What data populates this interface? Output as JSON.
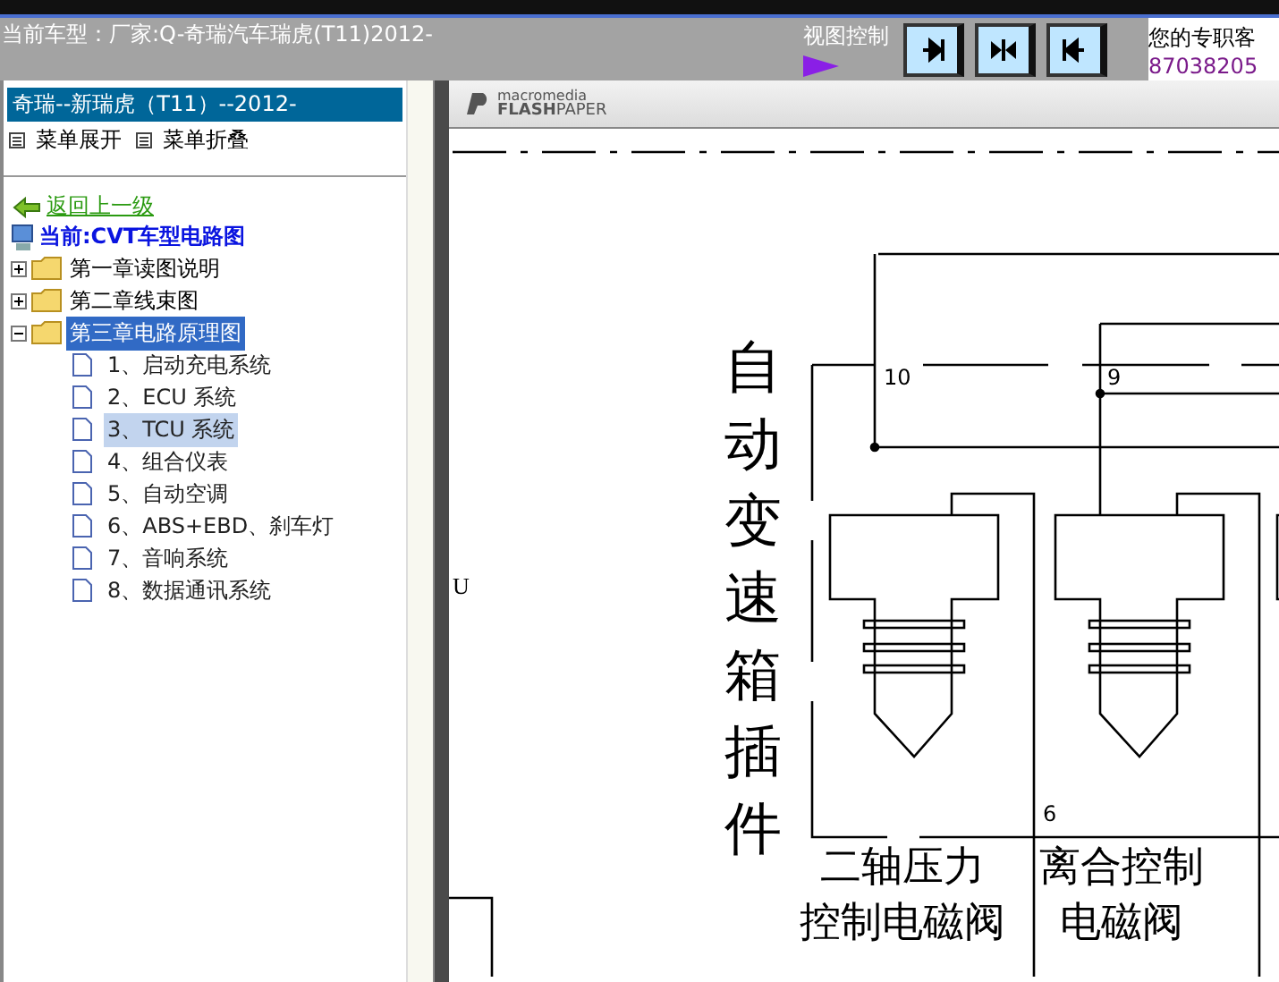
{
  "top_bar": {
    "vehicle_label": "当前车型：厂家:Q-奇瑞汽车瑞虎(T11)2012-",
    "view_control_label": "视图控制",
    "service_label": "您的专职客",
    "service_phone": "87038205"
  },
  "sidebar": {
    "title": "奇瑞--新瑞虎（T11）--2012-",
    "menu_actions": [
      "菜单展开",
      "菜单折叠"
    ],
    "back_link": "返回上一级",
    "current": "当前:CVT车型电路图",
    "chapters": [
      {
        "label": "第一章读图说明",
        "expanded": false,
        "selected": false
      },
      {
        "label": "第二章线束图",
        "expanded": false,
        "selected": false
      },
      {
        "label": "第三章电路原理图",
        "expanded": true,
        "selected": true,
        "children": [
          {
            "label": "1、启动充电系统",
            "selected": false
          },
          {
            "label": "2、ECU 系统",
            "selected": false
          },
          {
            "label": "3、TCU 系统",
            "selected": true
          },
          {
            "label": "4、组合仪表",
            "selected": false
          },
          {
            "label": "5、自动空调",
            "selected": false
          },
          {
            "label": "6、ABS+EBD、刹车灯",
            "selected": false
          },
          {
            "label": "7、音响系统",
            "selected": false
          },
          {
            "label": "8、数据通讯系统",
            "selected": false
          }
        ]
      }
    ]
  },
  "viewer": {
    "brand_top": "macromedia",
    "brand_bottom_bold": "FLASH",
    "brand_bottom": "PAPER",
    "margin_letter": "U",
    "connector_title": "自动变速箱插件",
    "pins": [
      {
        "label": "10"
      },
      {
        "label": "9"
      },
      {
        "label": "6"
      }
    ],
    "solenoids": [
      {
        "line_1": "二轴压力",
        "line_2": "控制电磁阀"
      },
      {
        "line_1": "离合控制",
        "line_2": "电磁阀"
      }
    ]
  }
}
